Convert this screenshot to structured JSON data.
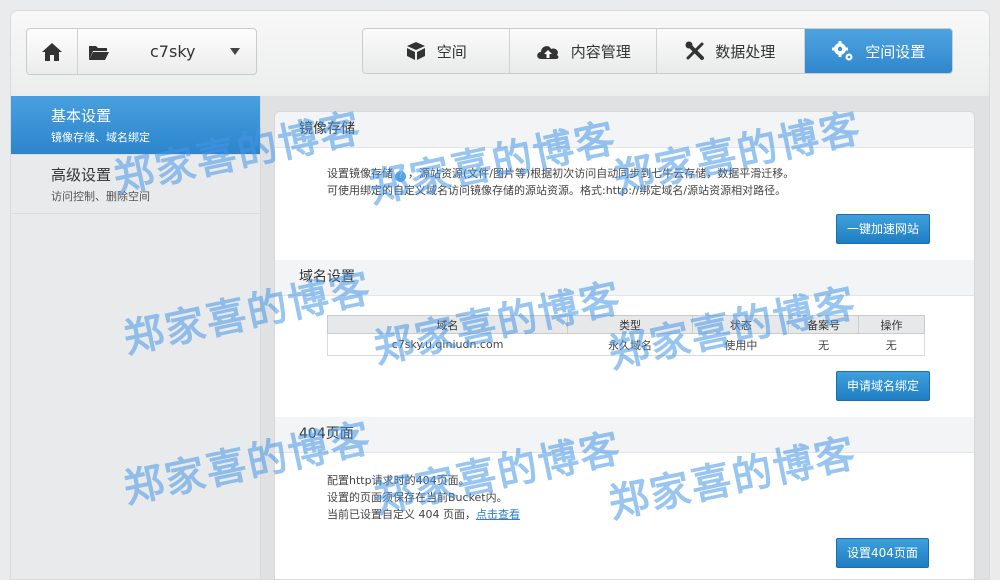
{
  "header": {
    "bucket_name": "c7sky",
    "tabs": [
      {
        "label": "空间",
        "icon": "cube-icon"
      },
      {
        "label": "内容管理",
        "icon": "cloud-upload-icon"
      },
      {
        "label": "数据处理",
        "icon": "tools-icon"
      },
      {
        "label": "空间设置",
        "icon": "gears-icon",
        "active": true
      }
    ]
  },
  "sidebar": {
    "items": [
      {
        "title": "基本设置",
        "subtitle": "镜像存储、域名绑定",
        "active": true
      },
      {
        "title": "高级设置",
        "subtitle": "访问控制、删除空间",
        "active": false
      }
    ]
  },
  "mirror": {
    "title": "镜像存储",
    "line1_a": "设置镜像存储",
    "line1_b": "，源站资源(文件/图片等)根据初次访问自动同步到七牛云存储，数据平滑迁移。",
    "line2": "可使用绑定的自定义域名访问镜像存储的源站资源。格式:http://绑定域名/源站资源相对路径。",
    "button": "一键加速网站"
  },
  "domain": {
    "title": "域名设置",
    "columns": [
      "域名",
      "类型",
      "状态",
      "备案号",
      "操作"
    ],
    "rows": [
      {
        "domain": "c7sky.u.qiniudn.com",
        "type": "永久域名",
        "status": "使用中",
        "icp": "无",
        "action": "无"
      }
    ],
    "button": "申请域名绑定"
  },
  "page404": {
    "title": "404页面",
    "line1": "配置http请求时的404页面。",
    "line2": "设置的页面须保存在当前Bucket内。",
    "line3": "当前已设置自定义 404 页面，",
    "link": "点击查看",
    "button": "设置404页面"
  },
  "watermark": "郑家喜的博客",
  "colors": {
    "accent": "#2f87cd",
    "watermark": "#4696e6"
  }
}
